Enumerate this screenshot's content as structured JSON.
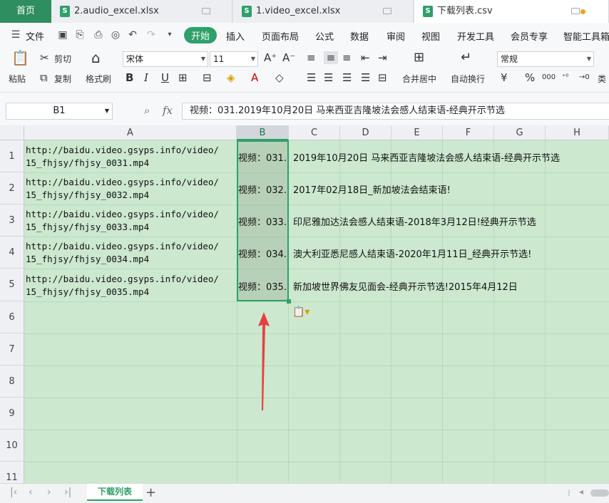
{
  "tabs": {
    "home": "首页",
    "files": [
      {
        "label": "2.audio_excel.xlsx",
        "active": false
      },
      {
        "label": "1.video_excel.xlsx",
        "active": false
      },
      {
        "label": "下载列表.csv",
        "active": true
      }
    ]
  },
  "menu": {
    "file": "文件",
    "items": [
      "开始",
      "插入",
      "页面布局",
      "公式",
      "数据",
      "审阅",
      "视图",
      "开发工具",
      "会员专享",
      "智能工具箱"
    ]
  },
  "ribbon": {
    "paste": "粘贴",
    "cut": "剪切",
    "copy": "复制",
    "format_painter": "格式刷",
    "font_name": "宋体",
    "font_size": "11",
    "merge_center": "合并居中",
    "wrap_text": "自动换行",
    "number_format": "常规",
    "currency_symbol": "¥",
    "percent_symbol": "%",
    "thousands": "000",
    "more": "类"
  },
  "formula_bar": {
    "cell_ref": "B1",
    "fx": "fx",
    "content": "视频：031.2019年10月20日 马来西亚吉隆坡法会感人结束语-经典开示节选"
  },
  "columns": [
    "A",
    "B",
    "C",
    "D",
    "E",
    "F",
    "G",
    "H"
  ],
  "rows": [
    "1",
    "2",
    "3",
    "4",
    "5",
    "6",
    "7",
    "8",
    "9",
    "10",
    "11"
  ],
  "cells": [
    {
      "a": "http://baidu.video.gsyps.info/video/\n15_fhjsy/fhjsy_0031.mp4",
      "b": "视频：031.",
      "c": "2019年10月20日 马来西亚吉隆坡法会感人结束语-经典开示节选"
    },
    {
      "a": "http://baidu.video.gsyps.info/video/\n15_fhjsy/fhjsy_0032.mp4",
      "b": "视频：032.",
      "c": "2017年02月18日_新加坡法会结束语!"
    },
    {
      "a": "http://baidu.video.gsyps.info/video/\n15_fhjsy/fhjsy_0033.mp4",
      "b": "视频：033.",
      "c": "印尼雅加达法会感人结束语-2018年3月12日!经典开示节选"
    },
    {
      "a": "http://baidu.video.gsyps.info/video/\n15_fhjsy/fhjsy_0034.mp4",
      "b": "视频：034.",
      "c": "澳大利亚悉尼感人结束语-2020年1月11日_经典开示节选!"
    },
    {
      "a": "http://baidu.video.gsyps.info/video/\n15_fhjsy/fhjsy_0035.mp4",
      "b": "视频：035.",
      "c": "新加坡世界佛友见面会-经典开示节选!2015年4月12日"
    }
  ],
  "sheet": {
    "name": "下载列表",
    "add": "+"
  },
  "colors": {
    "accent": "#2ea06a",
    "grid_bg": "#cce8cf",
    "arrow": "#e84040"
  }
}
